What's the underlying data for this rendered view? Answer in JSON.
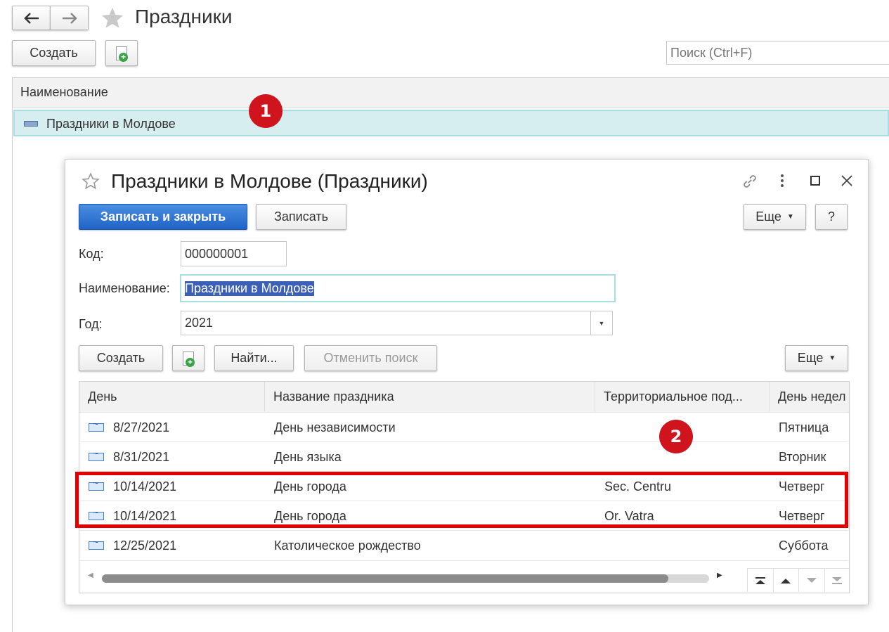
{
  "main": {
    "title": "Праздники",
    "create_label": "Создать",
    "search_placeholder": "Поиск (Ctrl+F)",
    "list_header": "Наименование",
    "list_items": [
      "Праздники в Молдове"
    ]
  },
  "dialog": {
    "title": "Праздники в Молдове (Праздники)",
    "save_close_label": "Записать и закрыть",
    "save_label": "Записать",
    "more_label": "Еще",
    "help_label": "?",
    "code_label": "Код:",
    "code_value": "000000001",
    "name_label": "Наименование:",
    "name_value": "Праздники в Молдове",
    "year_label": "Год:",
    "year_value": "2021",
    "table_toolbar": {
      "create_label": "Создать",
      "find_label": "Найти...",
      "cancel_search_label": "Отменить поиск",
      "more_label": "Еще"
    },
    "table": {
      "columns": [
        "День",
        "Название праздника",
        "Территориальное под...",
        "День недел"
      ],
      "rows": [
        {
          "day": "8/27/2021",
          "name": "День независимости",
          "territory": "",
          "weekday": "Пятница"
        },
        {
          "day": "8/31/2021",
          "name": "День языка",
          "territory": "",
          "weekday": "Вторник"
        },
        {
          "day": "10/14/2021",
          "name": "День города",
          "territory": "Sec. Centru",
          "weekday": "Четверг"
        },
        {
          "day": "10/14/2021",
          "name": "День города",
          "territory": "Or. Vatra",
          "weekday": "Четверг"
        },
        {
          "day": "12/25/2021",
          "name": "Католическое рождество",
          "territory": "",
          "weekday": "Суббота"
        }
      ]
    }
  },
  "annotations": {
    "badge1": "1",
    "badge2": "2"
  },
  "colors": {
    "accent": "#1f63c6",
    "highlight_row": "#d6eef0",
    "annotation_red": "#e50000"
  }
}
